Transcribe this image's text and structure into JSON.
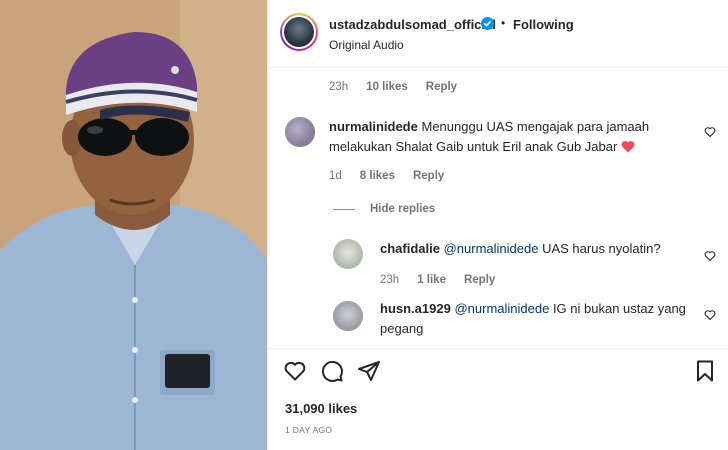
{
  "post": {
    "username": "ustadzabdulsomad_official",
    "dot": "•",
    "follow_label": "Following",
    "audio": "Original Audio",
    "likes": "31,090 likes",
    "time": "1 DAY AGO"
  },
  "top_comment_meta": {
    "time": "23h",
    "likes": "10 likes",
    "reply": "Reply"
  },
  "comments": [
    {
      "username": "nurmalinidede",
      "text": "Menunggu UAS mengajak para jamaah melakukan Shalat Gaib untuk Eril anak Gub Jabar",
      "line1": "Menunggu UAS mengajak para jamaah",
      "line2": "melakukan Shalat Gaib untuk Eril anak Gub Jabar",
      "emoji": "red-heart",
      "time": "1d",
      "likes": "8 likes",
      "reply": "Reply",
      "hide_replies": "Hide replies",
      "replies": [
        {
          "username": "chafidalie",
          "mention": "@nurmalinidede",
          "text": "UAS harus nyolatin?",
          "time": "23h",
          "likes": "1 like",
          "reply": "Reply"
        },
        {
          "username": "husn.a1929",
          "mention": "@nurmalinidede",
          "line1": "IG ni bukan ustaz yang",
          "line2": "pegang"
        }
      ]
    }
  ],
  "colors": {
    "verified": "#0095f6",
    "heart_emoji": "#ed4956",
    "meta": "#737373",
    "mention": "#00376b"
  },
  "icons": [
    "heart-icon",
    "comment-icon",
    "share-icon",
    "bookmark-icon",
    "verified-badge-icon"
  ]
}
